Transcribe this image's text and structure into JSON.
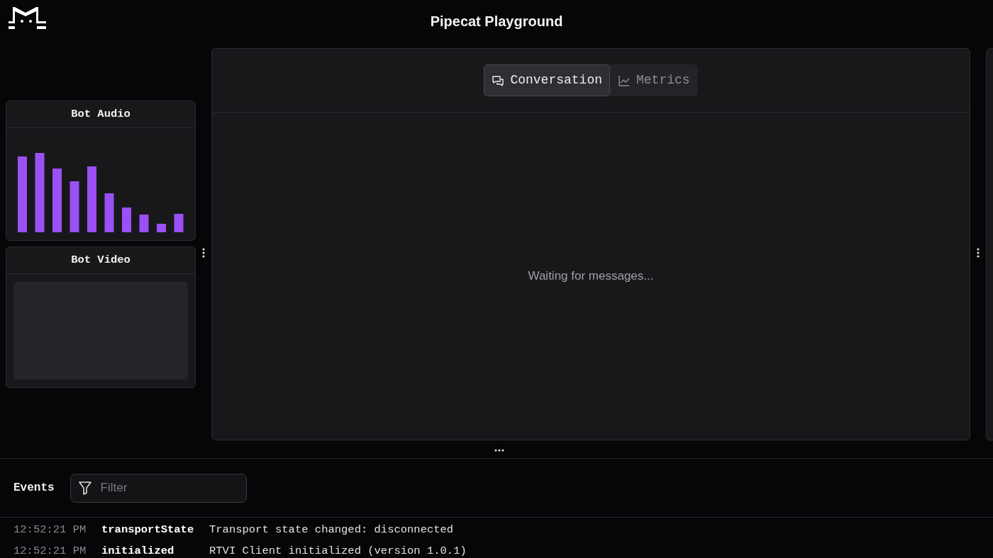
{
  "header": {
    "title": "Pipecat Playground"
  },
  "sidebar": {
    "panels": [
      {
        "kind": "audio",
        "title": "Bot Audio"
      },
      {
        "kind": "video",
        "title": "Bot Video"
      }
    ]
  },
  "main": {
    "tabs": [
      {
        "kind": "conversation",
        "label": "Conversation",
        "selected": true
      },
      {
        "kind": "metrics",
        "label": "Metrics",
        "selected": false
      }
    ],
    "empty_message": "Waiting for messages..."
  },
  "events": {
    "title": "Events",
    "filter": {
      "placeholder": "Filter"
    },
    "rows": [
      {
        "time": "12:52:21 PM",
        "type": "transportState",
        "message": "Transport state changed: disconnected"
      },
      {
        "time": "12:52:21 PM",
        "type": "initialized",
        "message": "RTVI Client initialized (version 1.0.1)"
      }
    ]
  }
}
